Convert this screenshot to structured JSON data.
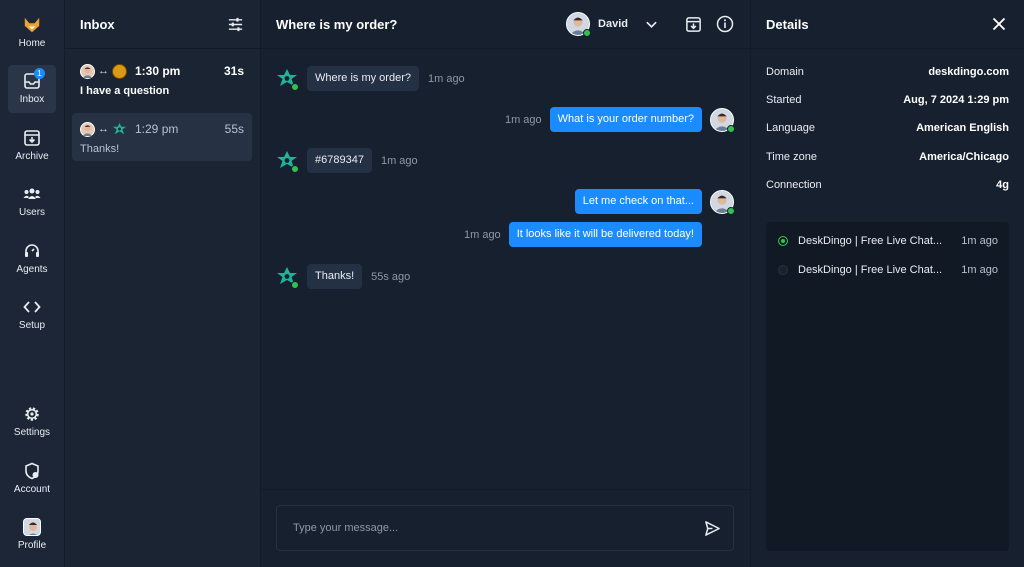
{
  "rail": {
    "home": "Home",
    "inbox": "Inbox",
    "inbox_badge": "1",
    "archive": "Archive",
    "users": "Users",
    "agents": "Agents",
    "setup": "Setup",
    "settings": "Settings",
    "account": "Account",
    "profile": "Profile"
  },
  "inbox": {
    "title": "Inbox",
    "conversations": [
      {
        "time": "1:30 pm",
        "age": "31s",
        "preview": "I have a question"
      },
      {
        "time": "1:29 pm",
        "age": "55s",
        "preview": "Thanks!"
      }
    ]
  },
  "chat": {
    "title": "Where is my order?",
    "agent_name": "David",
    "messages": [
      {
        "from": "visitor",
        "text": "Where is my order?",
        "time": "1m ago"
      },
      {
        "from": "agent",
        "text": "What is your order number?",
        "time": "1m ago"
      },
      {
        "from": "visitor",
        "text": "#6789347",
        "time": "1m ago"
      },
      {
        "from": "agent",
        "text": "Let me check on that...",
        "time": ""
      },
      {
        "from": "agent",
        "text": "It looks like it will be delivered today!",
        "time": "1m ago"
      },
      {
        "from": "visitor",
        "text": "Thanks!",
        "time": "55s ago"
      }
    ],
    "composer_placeholder": "Type your message..."
  },
  "details": {
    "title": "Details",
    "fields": [
      {
        "key": "Domain",
        "value": "deskdingo.com"
      },
      {
        "key": "Started",
        "value": "Aug, 7 2024 1:29 pm"
      },
      {
        "key": "Language",
        "value": "American English"
      },
      {
        "key": "Time zone",
        "value": "America/Chicago"
      },
      {
        "key": "Connection",
        "value": "4g"
      }
    ],
    "sessions": [
      {
        "name": "DeskDingo | Free Live Chat...",
        "age": "1m ago",
        "status": "active"
      },
      {
        "name": "DeskDingo | Free Live Chat...",
        "age": "1m ago",
        "status": "inactive"
      }
    ]
  },
  "colors": {
    "accent": "#1a8cff",
    "online": "#32c24d",
    "background": "#17202e"
  }
}
